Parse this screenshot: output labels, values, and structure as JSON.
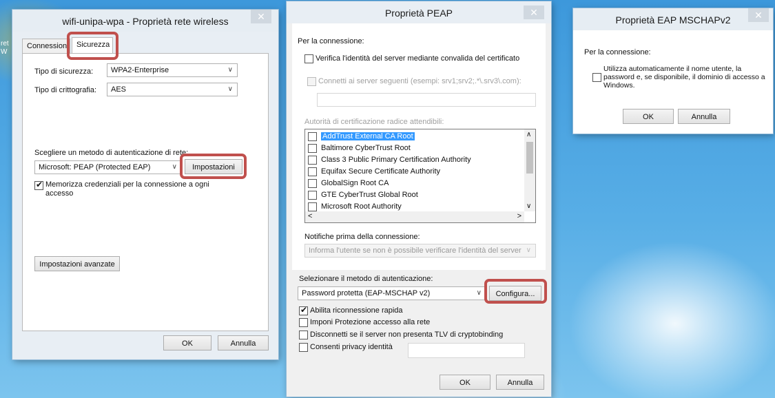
{
  "desktop": {
    "edge_text": "ret\nW"
  },
  "dlg1": {
    "title": "wifi-unipa-wpa - Proprietà rete wireless",
    "close": "✕",
    "tabs": [
      "Connessione",
      "Sicurezza"
    ],
    "security_type_label": "Tipo di sicurezza:",
    "security_type_value": "WPA2-Enterprise",
    "encryption_label": "Tipo di crittografia:",
    "encryption_value": "AES",
    "auth_method_label": "Scegliere un metodo di autenticazione di rete:",
    "auth_method_value": "Microsoft: PEAP (Protected EAP)",
    "settings_button": "Impostazioni",
    "remember_checkbox": "Memorizza credenziali per la connessione a ogni accesso",
    "remember_checked": true,
    "advanced_button": "Impostazioni avanzate",
    "ok": "OK",
    "cancel": "Annulla"
  },
  "dlg2": {
    "title": "Proprietà PEAP",
    "close": "✕",
    "connection_header": "Per la connessione:",
    "verify_cert": "Verifica l'identità del server mediante convalida del certificato",
    "connect_servers": "Connetti ai server seguenti (esempi: srv1;srv2;.*\\.srv3\\.com):",
    "root_ca_label": "Autorità di certificazione radice attendibili:",
    "ca_list": [
      "AddTrust External CA Root",
      "Baltimore CyberTrust Root",
      "Class 3 Public Primary Certification Authority",
      "Equifax Secure Certificate Authority",
      "GlobalSign Root CA",
      "GTE CyberTrust Global Root",
      "Microsoft Root Authority"
    ],
    "notify_label": "Notifiche prima della connessione:",
    "notify_value": "Informa l'utente se non è possibile verificare l'identità del server",
    "auth_method_label": "Selezionare il metodo di autenticazione:",
    "auth_method_value": "Password protetta (EAP-MSCHAP v2)",
    "configure_button": "Configura...",
    "options": [
      {
        "label": "Abilita riconnessione rapida",
        "checked": true
      },
      {
        "label": "Imponi Protezione accesso alla rete",
        "checked": false
      },
      {
        "label": "Disconnetti se il server non presenta TLV di cryptobinding",
        "checked": false
      },
      {
        "label": "Consenti privacy identità",
        "checked": false
      }
    ],
    "ok": "OK",
    "cancel": "Annulla"
  },
  "dlg3": {
    "title": "Proprietà EAP MSCHAPv2",
    "close": "✕",
    "connection_header": "Per la connessione:",
    "auto_use": "Utilizza automaticamente il nome utente, la password e, se disponibile, il dominio di accesso a Windows.",
    "ok": "OK",
    "cancel": "Annulla"
  },
  "colors": {
    "highlight": "#c0504d",
    "selection": "#3399ff",
    "desktop": "#4aa3e0"
  }
}
